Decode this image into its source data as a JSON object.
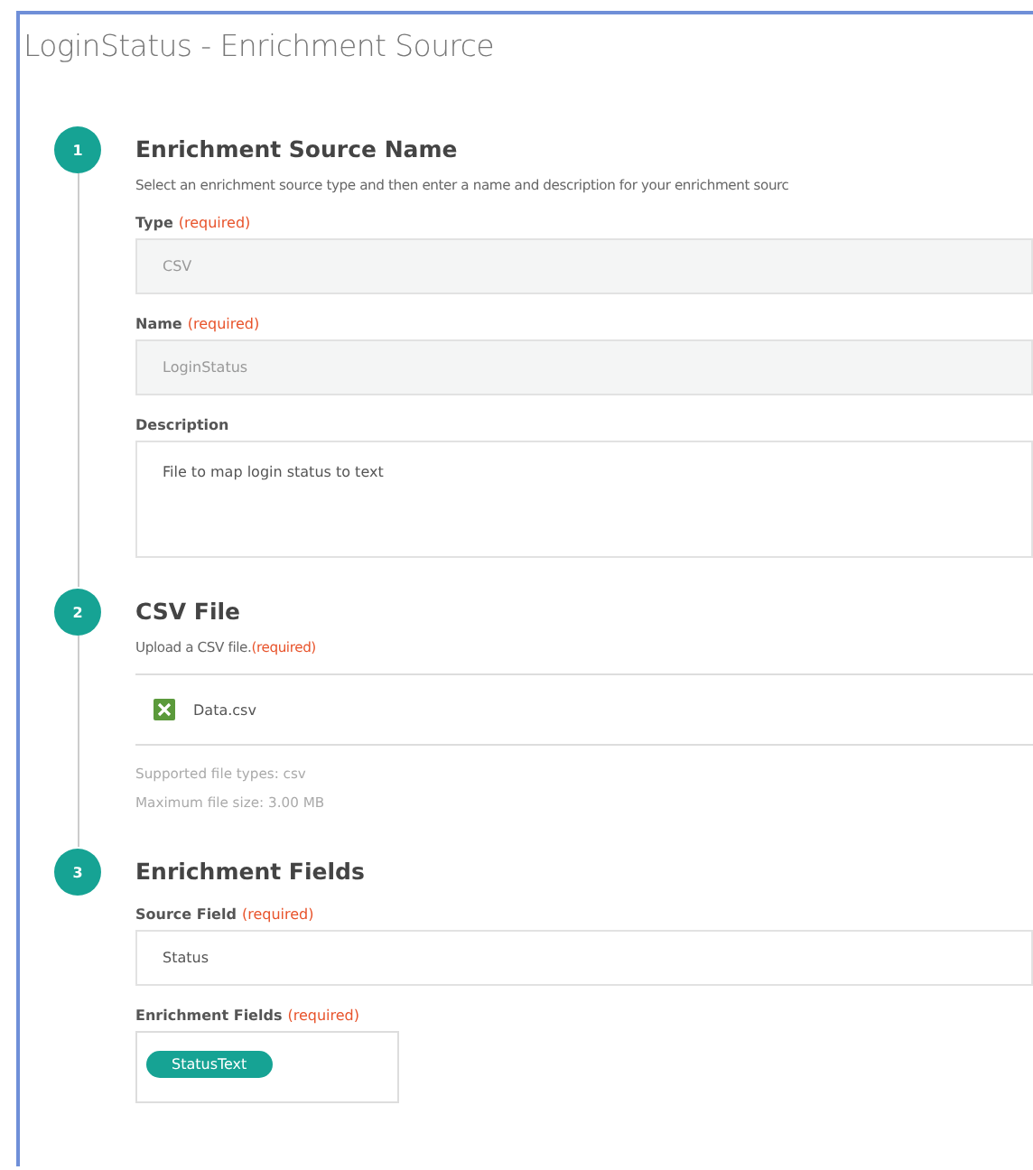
{
  "window": {
    "title": "LoginStatus - Enrichment Source"
  },
  "steps": [
    {
      "number": "1",
      "title": "Enrichment Source Name",
      "description": "Select an enrichment source type and then enter a name and description for your enrichment sourc",
      "fields": [
        {
          "kind": "input",
          "label": "Type",
          "required": "(required)",
          "value": "CSV",
          "disabled": true
        },
        {
          "kind": "input",
          "label": "Name",
          "required": "(required)",
          "value": "LoginStatus",
          "disabled": true
        },
        {
          "kind": "textarea",
          "label": "Description",
          "value": "File to map login status to text",
          "disabled": false
        }
      ]
    },
    {
      "number": "2",
      "title": "CSV File",
      "description": "Upload a CSV file.",
      "description_required": "(required)",
      "fields": [
        {
          "kind": "file",
          "value": "Data.csv",
          "notes": [
            "Supported file types: csv",
            "Maximum file size: 3.00 MB"
          ]
        }
      ]
    },
    {
      "number": "3",
      "title": "Enrichment Fields",
      "fields": [
        {
          "kind": "input",
          "label": "Source Field",
          "required": "(required)",
          "value": "Status",
          "disabled": false
        },
        {
          "kind": "tags",
          "label": "Enrichment Fields",
          "required": "(required)",
          "tags": [
            "StatusText"
          ]
        }
      ]
    }
  ]
}
